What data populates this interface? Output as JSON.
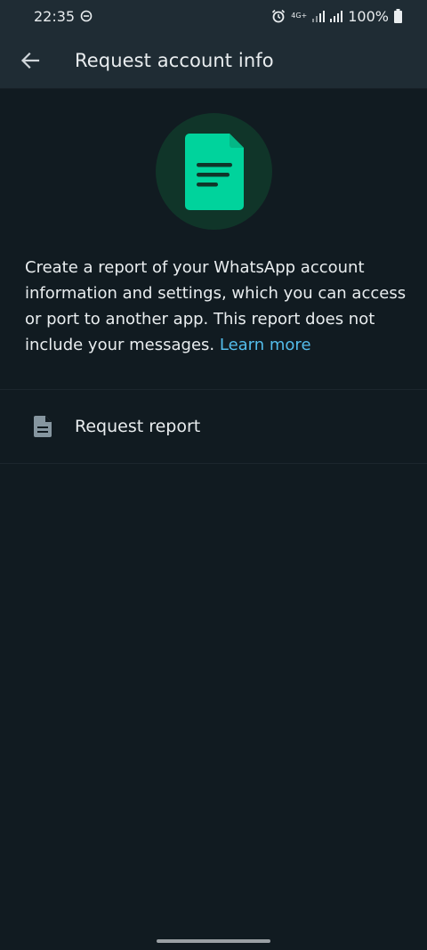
{
  "status_bar": {
    "time": "22:35",
    "network": "4G+",
    "battery": "100%"
  },
  "app_bar": {
    "title": "Request account info"
  },
  "hero": {
    "icon": "document-icon",
    "accent": "#00d39c"
  },
  "description": {
    "text": "Create a report of your WhatsApp account information and settings, which you can access or port to another app. This report does not include your messages. ",
    "link": "Learn more"
  },
  "actions": [
    {
      "icon": "document-icon",
      "label": "Request report"
    }
  ],
  "colors": {
    "background": "#111b21",
    "bar": "#1f2c34",
    "link": "#53bdeb"
  }
}
